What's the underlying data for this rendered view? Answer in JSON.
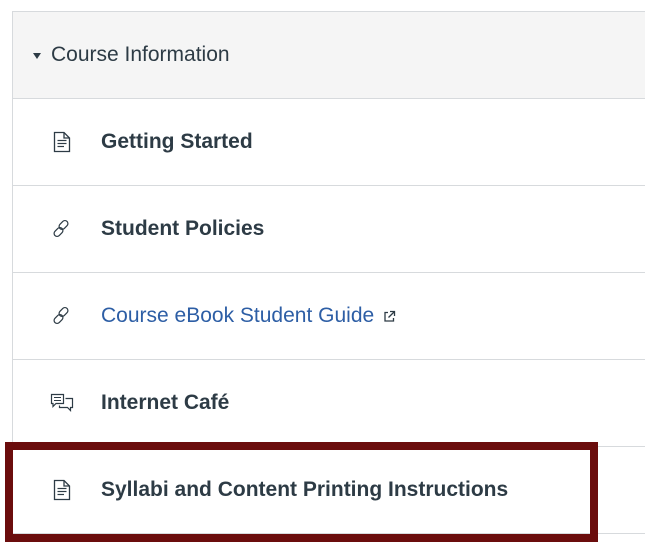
{
  "module": {
    "title": "Course Information",
    "items": [
      {
        "label": "Getting Started",
        "icon": "page-icon",
        "type": "page"
      },
      {
        "label": "Student Policies",
        "icon": "link-icon",
        "type": "link"
      },
      {
        "label": "Course eBook Student Guide",
        "icon": "link-icon",
        "type": "external-link"
      },
      {
        "label": "Internet Café",
        "icon": "discussion-icon",
        "type": "discussion"
      },
      {
        "label": "Syllabi and Content Printing Instructions",
        "icon": "page-icon",
        "type": "page"
      }
    ]
  },
  "colors": {
    "text": "#2d3b45",
    "link": "#2d5ea5",
    "header_bg": "#f5f5f5",
    "border": "#d7dadd",
    "highlight_border": "#6b0d0d"
  }
}
